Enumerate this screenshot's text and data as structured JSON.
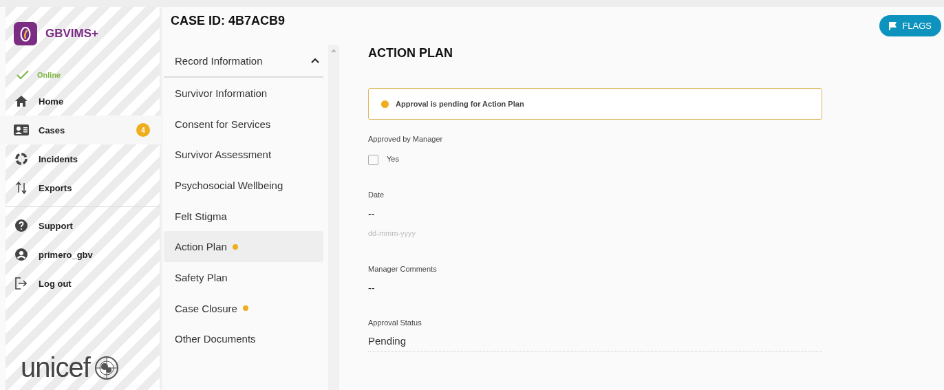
{
  "app": {
    "name": "GBVIMS+",
    "status": "Online",
    "footer_logo": "unicef"
  },
  "sidebar": {
    "items": [
      {
        "kind": "home",
        "label": "Home",
        "selected": false
      },
      {
        "kind": "cases",
        "label": "Cases",
        "selected": true,
        "badge": "4"
      },
      {
        "kind": "incidents",
        "label": "Incidents",
        "selected": false
      },
      {
        "kind": "exports",
        "label": "Exports",
        "selected": false
      }
    ],
    "bottom_items": [
      {
        "kind": "support",
        "label": "Support"
      },
      {
        "kind": "user",
        "label": "primero_gbv"
      },
      {
        "kind": "logout",
        "label": "Log out"
      }
    ]
  },
  "header": {
    "title": "CASE ID: 4B7ACB9",
    "flags_button": "FLAGS"
  },
  "form_nav": {
    "group": {
      "label": "Record Information",
      "expanded": true
    },
    "items": [
      {
        "label": "Survivor Information",
        "selected": false,
        "pending": false
      },
      {
        "label": "Consent for Services",
        "selected": false,
        "pending": false
      },
      {
        "label": "Survivor Assessment",
        "selected": false,
        "pending": false
      },
      {
        "label": "Psychosocial Wellbeing",
        "selected": false,
        "pending": false
      },
      {
        "label": "Felt Stigma",
        "selected": false,
        "pending": false
      },
      {
        "label": "Action Plan",
        "selected": true,
        "pending": true
      },
      {
        "label": "Safety Plan",
        "selected": false,
        "pending": false
      },
      {
        "label": "Case Closure",
        "selected": false,
        "pending": true
      },
      {
        "label": "Other Documents",
        "selected": false,
        "pending": false
      }
    ]
  },
  "form": {
    "title": "ACTION PLAN",
    "alert": "Approval is pending for Action Plan",
    "fields": [
      {
        "kind": "checkbox",
        "label": "Approved by Manager",
        "option": "Yes",
        "checked": false
      },
      {
        "kind": "date",
        "label": "Date",
        "value": "--",
        "placeholder": "dd-mmm-yyyy"
      },
      {
        "kind": "text",
        "label": "Manager Comments",
        "value": "--"
      },
      {
        "kind": "select",
        "label": "Approval Status",
        "value": "Pending"
      }
    ]
  }
}
